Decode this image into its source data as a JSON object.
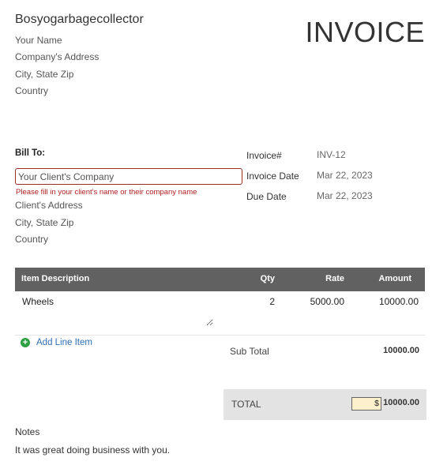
{
  "sender": {
    "company_name": "Bosyogarbagecollector",
    "your_name": "Your Name",
    "address": "Company's Address",
    "city_state_zip": "City, State Zip",
    "country": "Country"
  },
  "title": "INVOICE",
  "bill_to": {
    "label": "Bill To:",
    "client_company_value": "Your Client's Company",
    "error_message": "Please fill in your client's name or their company name",
    "client_address": "Client's Address",
    "city_state_zip": "City, State Zip",
    "country": "Country"
  },
  "meta": {
    "invoice_number_label": "Invoice#",
    "invoice_number_value": "INV-12",
    "invoice_date_label": "Invoice Date",
    "invoice_date_value": "Mar 22, 2023",
    "due_date_label": "Due Date",
    "due_date_value": "Mar 22, 2023"
  },
  "table": {
    "headers": {
      "description": "Item Description",
      "qty": "Qty",
      "rate": "Rate",
      "amount": "Amount"
    },
    "rows": [
      {
        "description": "Wheels",
        "qty": "2",
        "rate": "5000.00",
        "amount": "10000.00"
      }
    ],
    "add_line_label": "Add Line Item"
  },
  "totals": {
    "subtotal_label": "Sub Total",
    "subtotal_value": "10000.00",
    "total_label": "TOTAL",
    "currency_symbol": "$",
    "total_value": "10000.00"
  },
  "notes": {
    "label": "Notes",
    "text": "It was great doing business with you."
  },
  "colors": {
    "table_header_bg": "#616161",
    "error": "#b02020",
    "add_icon": "#2ea043",
    "link": "#2f6fb0",
    "total_bg": "#e3e3e3",
    "currency_bg": "#fdf0cc"
  },
  "icons": {
    "add_line": "plus-circle-icon"
  }
}
